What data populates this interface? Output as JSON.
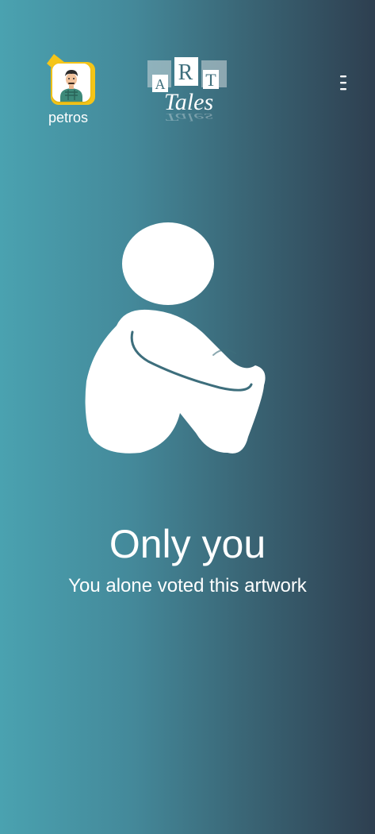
{
  "header": {
    "username": "petros",
    "logo": {
      "letters": [
        "A",
        "R",
        "T"
      ],
      "word": "Tales",
      "reflection": "Tales"
    },
    "menu_icon": "more-vertical-icon",
    "avatar_icon": "user-avatar-icon",
    "tag_icon": "tag-icon"
  },
  "main": {
    "illustration_icon": "sitting-person-icon",
    "title": "Only you",
    "subtitle": "You alone voted this artwork"
  },
  "colors": {
    "gradient_left": "#4aa2b0",
    "gradient_right": "#2e3f50",
    "tag_yellow": "#f5c518",
    "text": "#ffffff"
  }
}
